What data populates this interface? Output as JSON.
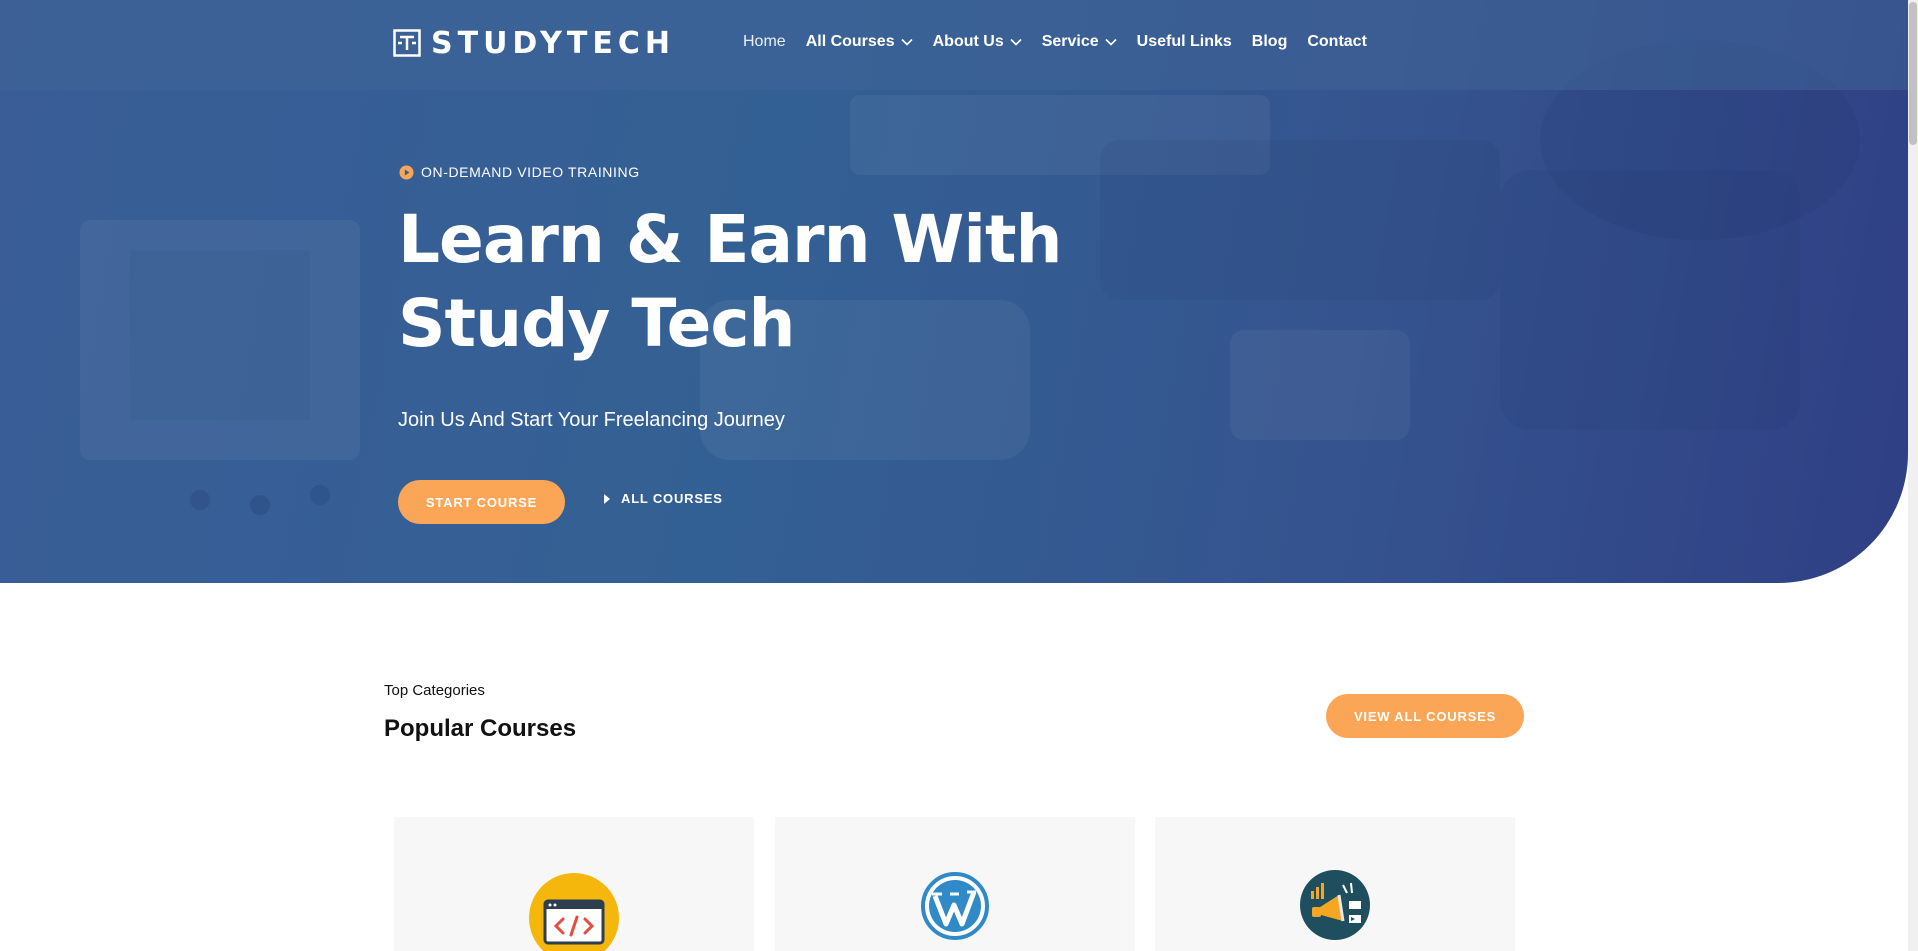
{
  "header": {
    "logo_text": "STUDYTECH",
    "nav": [
      {
        "label": "Home",
        "dropdown": false,
        "active": true
      },
      {
        "label": "All Courses",
        "dropdown": true
      },
      {
        "label": "About Us",
        "dropdown": true
      },
      {
        "label": "Service",
        "dropdown": true
      },
      {
        "label": "Useful Links",
        "dropdown": false
      },
      {
        "label": "Blog",
        "dropdown": false
      },
      {
        "label": "Contact",
        "dropdown": false
      }
    ]
  },
  "hero": {
    "eyebrow": "ON-DEMAND VIDEO TRAINING",
    "headline_line1": "Learn & Earn With",
    "headline_line2": "Study Tech",
    "subtitle": "Join Us And Start Your Freelancing Journey",
    "start_button": "START COURSE",
    "all_courses_link": "ALL COURSES"
  },
  "categories": {
    "label": "Top Categories",
    "title": "Popular Courses",
    "view_all_button": "VIEW ALL COURSES",
    "cards": [
      {
        "icon": "code-window-icon"
      },
      {
        "icon": "wordpress-icon"
      },
      {
        "icon": "digital-marketing-megaphone-icon"
      }
    ]
  },
  "colors": {
    "accent": "#fba556",
    "hero_blue": "#336094",
    "card_bg": "#f7f7f7"
  }
}
